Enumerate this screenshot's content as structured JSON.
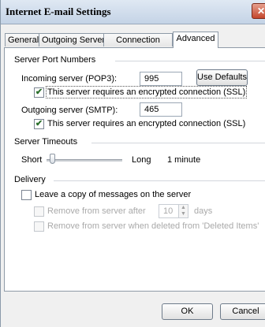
{
  "window": {
    "title": "Internet E-mail Settings",
    "close_glyph": "✕"
  },
  "tabs": [
    {
      "label": "General"
    },
    {
      "label": "Outgoing Server"
    },
    {
      "label": "Connection"
    },
    {
      "label": "Advanced"
    }
  ],
  "ports": {
    "group_label": "Server Port Numbers",
    "incoming_label": "Incoming server (POP3):",
    "incoming_value": "995",
    "use_defaults": "Use Defaults",
    "incoming_ssl_label": "This server requires an encrypted connection (SSL)",
    "incoming_ssl_checked": true,
    "outgoing_label": "Outgoing server (SMTP):",
    "outgoing_value": "465",
    "outgoing_ssl_label": "This server requires an encrypted connection (SSL)",
    "outgoing_ssl_checked": true
  },
  "timeouts": {
    "group_label": "Server Timeouts",
    "short_label": "Short",
    "long_label": "Long",
    "value_text": "1 minute",
    "slider_fraction": 0.05
  },
  "delivery": {
    "group_label": "Delivery",
    "leave_copy_label": "Leave a copy of messages on the server",
    "leave_copy_checked": false,
    "remove_after_label": "Remove from server after",
    "remove_after_value": "10",
    "days_label": "days",
    "remove_deleted_label": "Remove from server when deleted from 'Deleted Items'"
  },
  "buttons": {
    "ok": "OK",
    "cancel": "Cancel"
  }
}
